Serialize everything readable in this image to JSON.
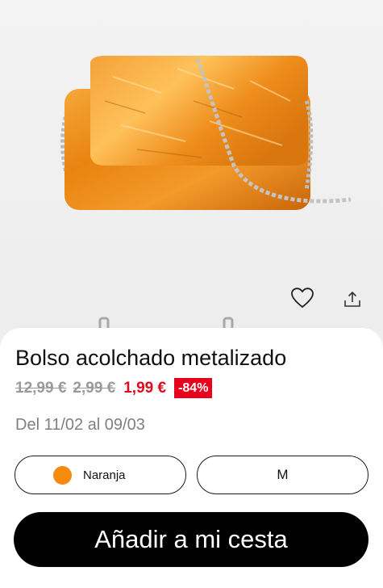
{
  "product": {
    "name": "Bolso acolchado metalizado",
    "price_original": "12,99 €",
    "price_previous": "2,99 €",
    "price_current": "1,99 €",
    "discount": "-84%",
    "delivery": "Del 11/02 al 09/03"
  },
  "options": {
    "color_label": "Naranja",
    "color_hex": "#f58a0b",
    "size_label": "M"
  },
  "actions": {
    "add_to_cart": "Añadir a mi cesta"
  },
  "icons": [
    "heart-icon",
    "share-icon"
  ],
  "colors": {
    "accent_red": "#e8001c",
    "cta_black": "#000000"
  }
}
